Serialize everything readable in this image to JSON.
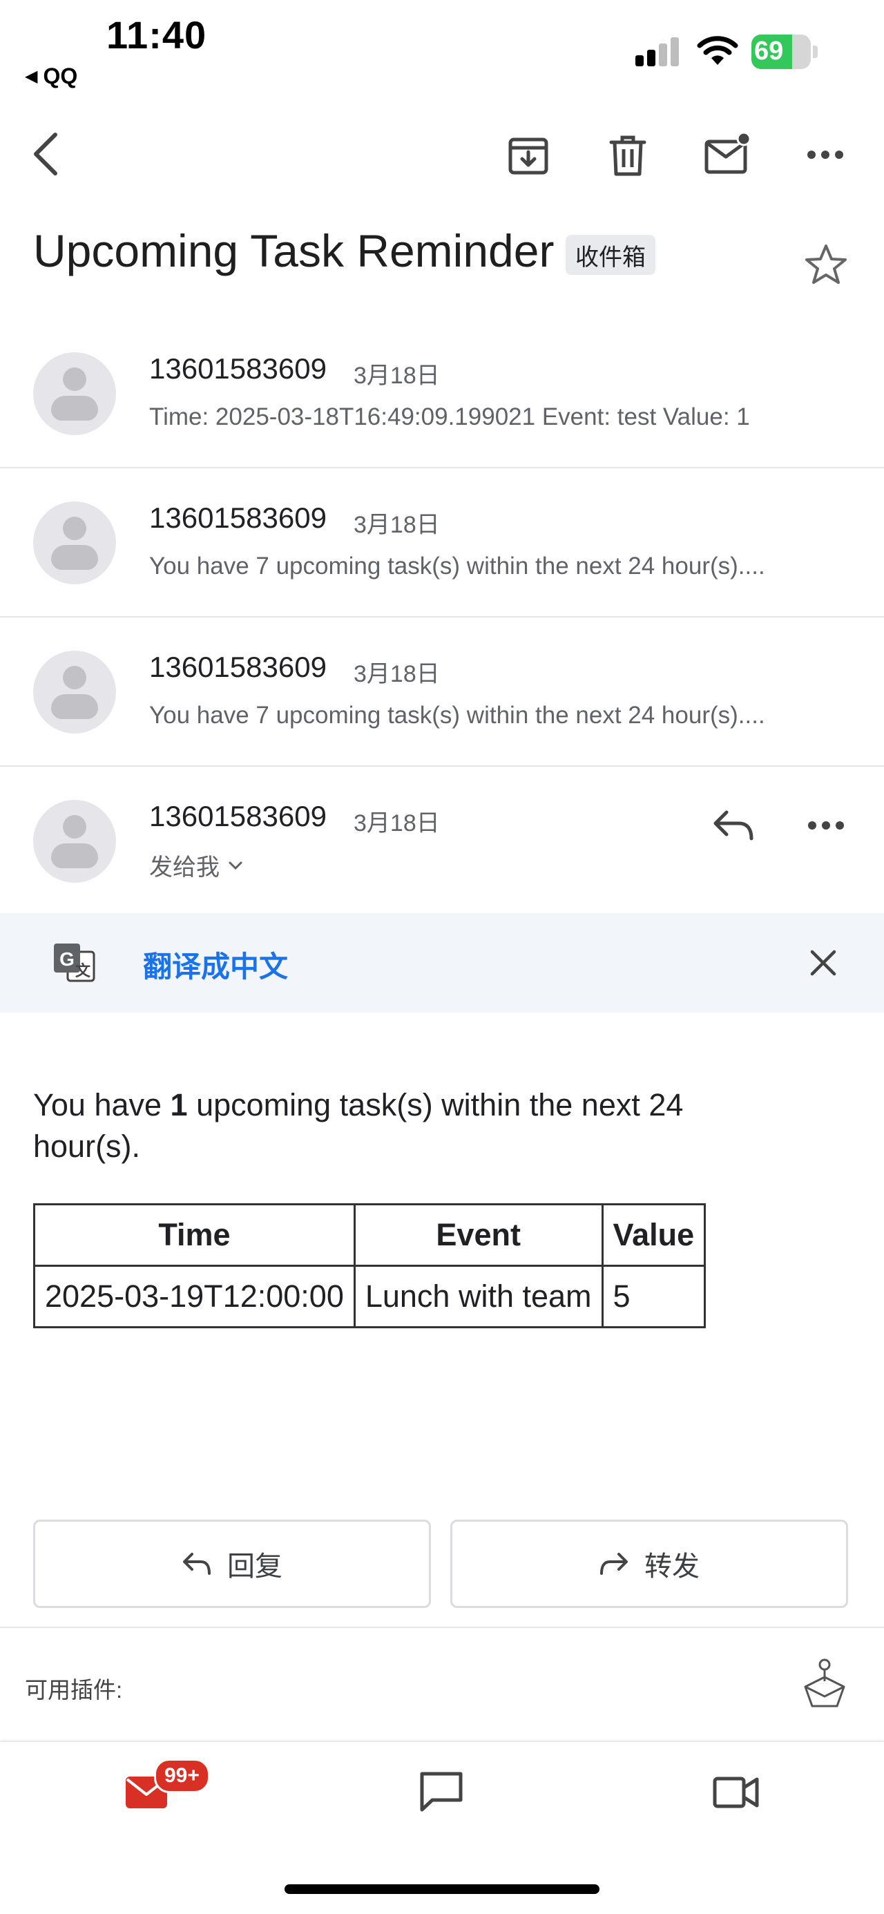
{
  "status_bar": {
    "time": "11:40",
    "back_app": "QQ",
    "battery": "69",
    "battery_level_percent": 69
  },
  "action_bar": {
    "icons": [
      "back-arrow-icon",
      "archive-icon",
      "delete-icon",
      "mark-unread-icon",
      "more-icon"
    ]
  },
  "subject": {
    "title": "Upcoming Task Reminder",
    "label": "收件箱"
  },
  "thread": [
    {
      "sender": "13601583609",
      "date": "3月18日",
      "snippet": "Time: 2025-03-18T16:49:09.199021 Event: test Value: 1"
    },
    {
      "sender": "13601583609",
      "date": "3月18日",
      "snippet": "You have 7 upcoming task(s) within the next 24 hour(s)...."
    },
    {
      "sender": "13601583609",
      "date": "3月18日",
      "snippet": "You have 7 upcoming task(s) within the next 24 hour(s)...."
    }
  ],
  "open_message": {
    "sender": "13601583609",
    "date": "3月18日",
    "recipient": "发给我"
  },
  "translate": {
    "link": "翻译成中文"
  },
  "body": {
    "text_before": "You have ",
    "count": "1",
    "text_after": " upcoming task(s) within the next 24 hour(s).",
    "table": {
      "headers": [
        "Time",
        "Event",
        "Value"
      ],
      "rows": [
        [
          "2025-03-19T12:00:00",
          "Lunch with team",
          "5"
        ]
      ]
    }
  },
  "actions": {
    "reply": "回复",
    "forward": "转发"
  },
  "plugins": {
    "label": "可用插件:"
  },
  "bottom_nav": {
    "mail_badge": "99+",
    "items": [
      "mail-icon",
      "chat-icon",
      "video-icon"
    ]
  },
  "colors": {
    "accent_red": "#d93025",
    "link_blue": "#1a73e8",
    "battery_green": "#34c759",
    "translate_bg": "#f2f6fa"
  }
}
